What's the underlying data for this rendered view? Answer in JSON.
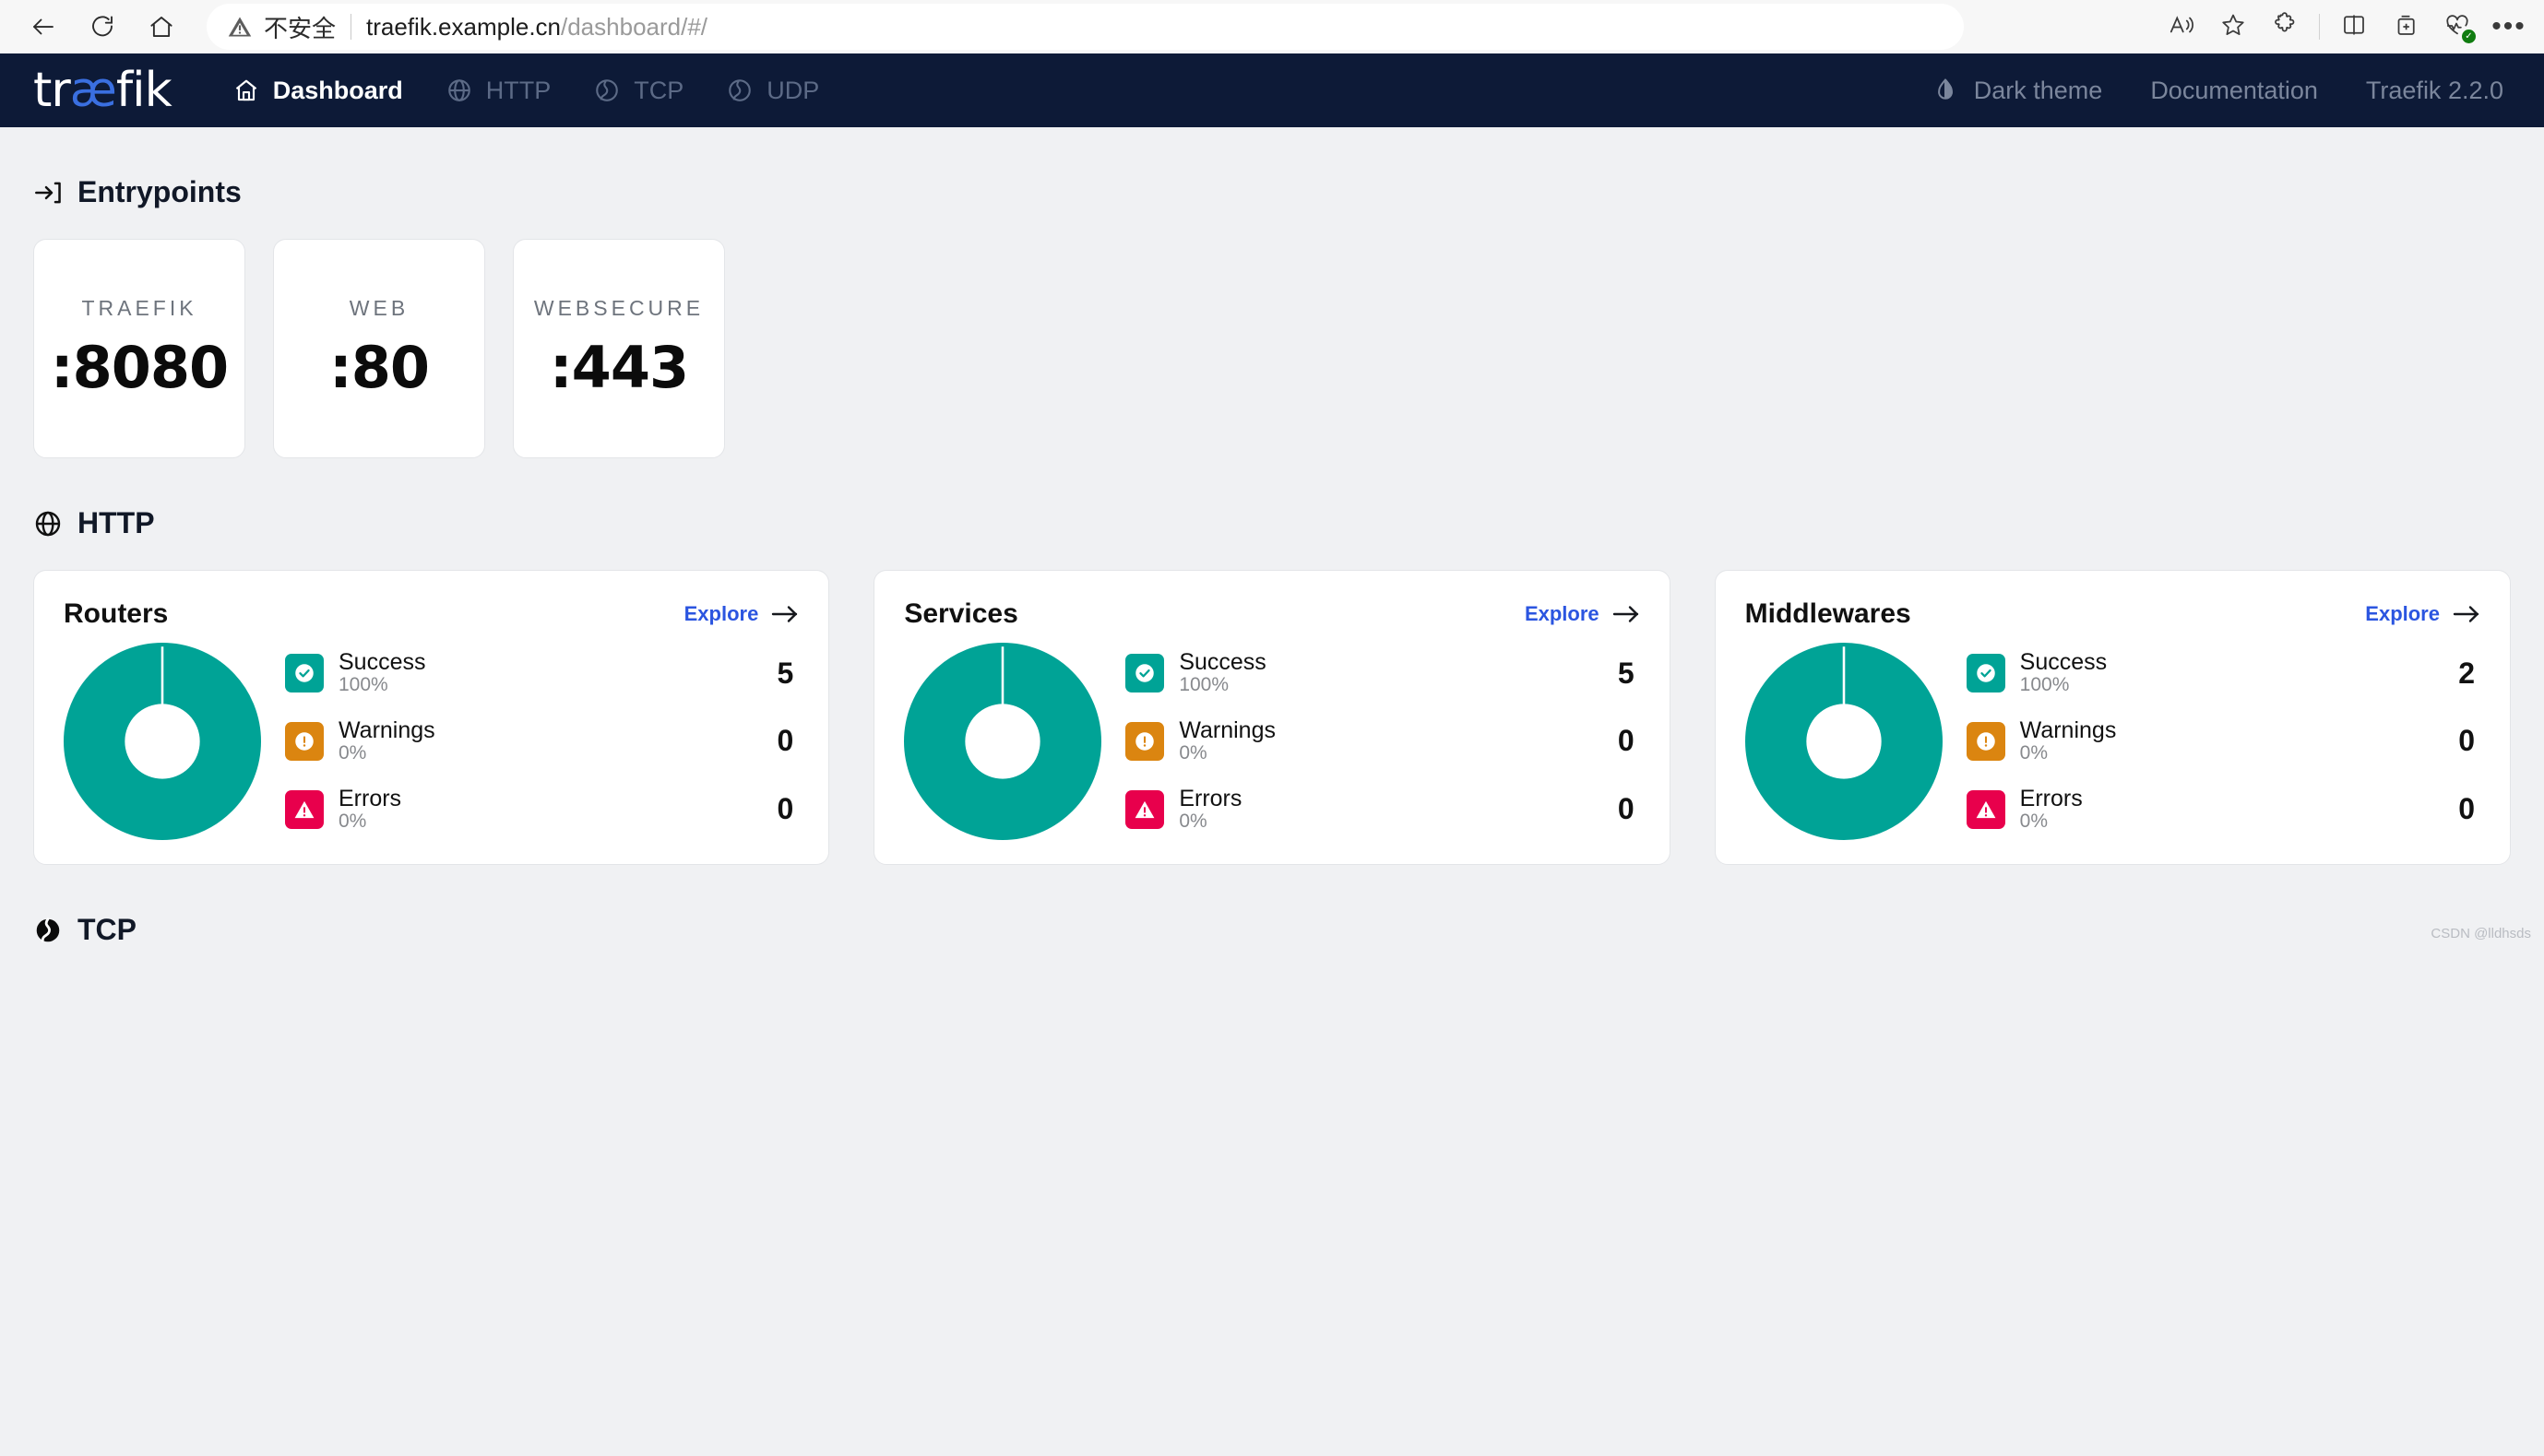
{
  "browser": {
    "back_icon": "back-arrow-icon",
    "reload_icon": "reload-icon",
    "home_icon": "home-icon",
    "security_label": "不安全",
    "url_domain": "traefik.example.cn",
    "url_path": "/dashboard/#/",
    "toolbar_icons": [
      "read-aloud-icon",
      "favorite-star-icon",
      "extensions-icon",
      "split-screen-icon",
      "collections-icon",
      "browser-essentials-icon",
      "settings-more-icon"
    ]
  },
  "navbar": {
    "logo_prefix": "tr",
    "logo_ae": "æ",
    "logo_suffix": "fik",
    "items": [
      {
        "label": "Dashboard",
        "icon": "home-icon",
        "active": true
      },
      {
        "label": "HTTP",
        "icon": "globe-icon",
        "active": false
      },
      {
        "label": "TCP",
        "icon": "tcp-globe-icon",
        "active": false
      },
      {
        "label": "UDP",
        "icon": "udp-globe-icon",
        "active": false
      }
    ],
    "theme_toggle": "Dark theme",
    "theme_icon": "contrast-droplet-icon",
    "documentation": "Documentation",
    "version": "Traefik 2.2.0"
  },
  "entrypoints": {
    "section_title": "Entrypoints",
    "section_icon": "entry-arrow-icon",
    "cards": [
      {
        "name": "TRAEFIK",
        "port": ":8080"
      },
      {
        "name": "WEB",
        "port": ":80"
      },
      {
        "name": "WEBSECURE",
        "port": ":443"
      }
    ]
  },
  "http": {
    "section_title": "HTTP",
    "section_icon": "globe-icon",
    "explore_label": "Explore",
    "explore_icon": "arrow-right-icon",
    "cards": [
      {
        "title": "Routers",
        "chart_data": {
          "type": "pie",
          "title": "Routers",
          "categories": [
            "Success",
            "Warnings",
            "Errors"
          ],
          "values": [
            5,
            0,
            0
          ],
          "percentages": [
            "100%",
            "0%",
            "0%"
          ],
          "colors": [
            "#00a396",
            "#db8510",
            "#e8004c"
          ],
          "total": 5,
          "legend": "right",
          "donut": true
        },
        "stats": [
          {
            "label": "Success",
            "pct": "100%",
            "value": "5",
            "kind": "success",
            "icon": "check-circle-icon"
          },
          {
            "label": "Warnings",
            "pct": "0%",
            "value": "0",
            "kind": "warning",
            "icon": "exclamation-circle-icon"
          },
          {
            "label": "Errors",
            "pct": "0%",
            "value": "0",
            "kind": "error",
            "icon": "exclamation-triangle-icon"
          }
        ]
      },
      {
        "title": "Services",
        "chart_data": {
          "type": "pie",
          "title": "Services",
          "categories": [
            "Success",
            "Warnings",
            "Errors"
          ],
          "values": [
            5,
            0,
            0
          ],
          "percentages": [
            "100%",
            "0%",
            "0%"
          ],
          "colors": [
            "#00a396",
            "#db8510",
            "#e8004c"
          ],
          "total": 5,
          "legend": "right",
          "donut": true
        },
        "stats": [
          {
            "label": "Success",
            "pct": "100%",
            "value": "5",
            "kind": "success",
            "icon": "check-circle-icon"
          },
          {
            "label": "Warnings",
            "pct": "0%",
            "value": "0",
            "kind": "warning",
            "icon": "exclamation-circle-icon"
          },
          {
            "label": "Errors",
            "pct": "0%",
            "value": "0",
            "kind": "error",
            "icon": "exclamation-triangle-icon"
          }
        ]
      },
      {
        "title": "Middlewares",
        "chart_data": {
          "type": "pie",
          "title": "Middlewares",
          "categories": [
            "Success",
            "Warnings",
            "Errors"
          ],
          "values": [
            2,
            0,
            0
          ],
          "percentages": [
            "100%",
            "0%",
            "0%"
          ],
          "colors": [
            "#00a396",
            "#db8510",
            "#e8004c"
          ],
          "total": 2,
          "legend": "right",
          "donut": true
        },
        "stats": [
          {
            "label": "Success",
            "pct": "100%",
            "value": "2",
            "kind": "success",
            "icon": "check-circle-icon"
          },
          {
            "label": "Warnings",
            "pct": "0%",
            "value": "0",
            "kind": "warning",
            "icon": "exclamation-circle-icon"
          },
          {
            "label": "Errors",
            "pct": "0%",
            "value": "0",
            "kind": "error",
            "icon": "exclamation-triangle-icon"
          }
        ]
      }
    ]
  },
  "tcp": {
    "section_title": "TCP",
    "section_icon": "tcp-filled-icon"
  },
  "watermark": "CSDN @lldhsds",
  "colors": {
    "navbar_bg": "#0d1a37",
    "page_bg": "#f0f1f3",
    "accent_blue": "#2b55e0",
    "logo_blue": "#3a6fe0",
    "success": "#00a396",
    "warning": "#db8510",
    "error": "#e8004c"
  }
}
